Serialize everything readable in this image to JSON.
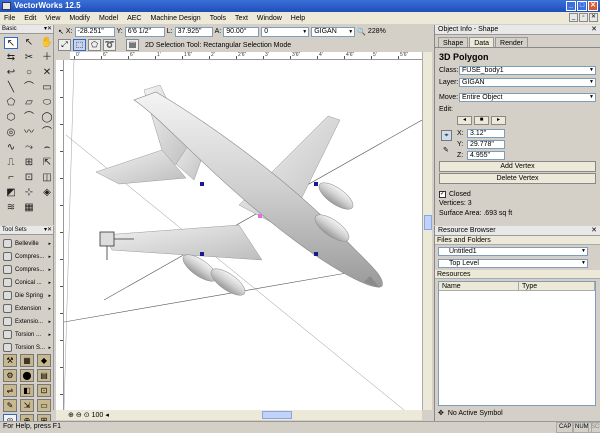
{
  "app": {
    "title": "VectorWorks 12.5"
  },
  "menu": [
    "File",
    "Edit",
    "View",
    "Modify",
    "Model",
    "AEC",
    "Machine Design",
    "Tools",
    "Text",
    "Window",
    "Help"
  ],
  "databar": {
    "x": "-28.251\"",
    "y": "6'6 1/2\"",
    "l": "37.925\"",
    "a": "90.00°",
    "z": "0",
    "layer": "GIGAN",
    "zoom": "228%",
    "x_label": "X:",
    "y_label": "Y:",
    "l_label": "L:",
    "a_label": "A:"
  },
  "modebar": {
    "text": "2D Selection Tool: Rectangular Selection Mode"
  },
  "basic_palette": {
    "title": "Basic",
    "tools": [
      "↖",
      "↖",
      "✋",
      "⇆",
      "✂",
      "＋",
      "↩",
      "○",
      "✕",
      "╲",
      "⌒",
      "▭",
      "⬠",
      "▱",
      "⬭",
      "⬡",
      "⌒",
      "◯",
      "◎",
      "〰",
      "⌒",
      "∿",
      "⤳",
      "⌢",
      "⎍",
      "⊞",
      "⇱",
      "⌐",
      "⊡",
      "◫",
      "◩",
      "⊹",
      "◈",
      "≋",
      "▦",
      ""
    ]
  },
  "tool_sets": {
    "title": "Tool Sets",
    "items": [
      "Belleville",
      "Compres...",
      "Compres...",
      "Conical ...",
      "Die Spring",
      "Extension",
      "Extensio...",
      "Torsion ...",
      "Torsion S..."
    ],
    "buttons": [
      "⚒",
      "▦",
      "◆",
      "⚙",
      "⬤",
      "▤",
      "⇌",
      "◧",
      "⊡",
      "✎",
      "⇲",
      "▭",
      "◎",
      "⊕",
      "⊞"
    ]
  },
  "ruler": {
    "h_labels": [
      "0'",
      "6\"",
      "6\"",
      "1'",
      "1'6\"",
      "2'",
      "2'6\"",
      "3'",
      "3'6\"",
      "4'",
      "4'6\"",
      "5'",
      "5'6\""
    ]
  },
  "bottom": {
    "zoom_value": "100"
  },
  "status": {
    "text": "For Help, press F1",
    "cap": "CAP",
    "num": "NUM",
    "scrl": "SCRL"
  },
  "oip": {
    "title": "Object Info - Shape",
    "tabs": [
      "Shape",
      "Data",
      "Render"
    ],
    "object_type": "3D Polygon",
    "class_label": "Class:",
    "class_value": "FUSE_body1",
    "layer_label": "Layer:",
    "layer_value": "GIGAN",
    "move_label": "Move:",
    "move_value": "Entire Object",
    "edit_label": "Edit:",
    "x_label": "X:",
    "x_value": "3.12\"",
    "y_label": "Y:",
    "y_value": "29.778\"",
    "z_label": "Z:",
    "z_value": "4.955\"",
    "add_vertex": "Add Vertex",
    "delete_vertex": "Delete Vertex",
    "closed_label": "Closed",
    "vertices": "Vertices: 3",
    "surface": "Surface Area: .693 sq ft"
  },
  "resource_browser": {
    "title": "Resource Browser",
    "files_label": "Files and Folders",
    "file_value": "Untitled1",
    "level_value": "Top Level",
    "resources_label": "Resources",
    "col_name": "Name",
    "col_type": "Type",
    "footer": "No Active Symbol"
  }
}
